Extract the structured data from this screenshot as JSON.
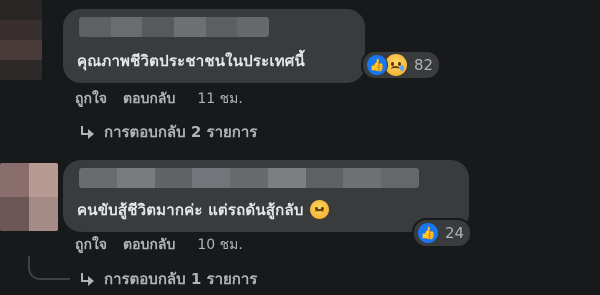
{
  "comments": [
    {
      "text": "คุณภาพชีวิตประชาชนในประเทศนี้",
      "reactions": {
        "icons": [
          "like-icon",
          "sad-icon"
        ],
        "count": "82"
      },
      "actions": {
        "like": "ถูกใจ",
        "reply": "ตอบกลับ",
        "time": "11 ชม."
      },
      "replies_label": "การตอบกลับ 2 รายการ"
    },
    {
      "text": "คนขับสู้ชีวิตมากค่ะ แต่รถดันสู้กลับ",
      "inline_emoji": "sad-face-emoji",
      "reactions": {
        "icons": [
          "like-icon"
        ],
        "count": "24"
      },
      "actions": {
        "like": "ถูกใจ",
        "reply": "ตอบกลับ",
        "time": "10 ชม."
      },
      "replies_label": "การตอบกลับ 1 รายการ"
    }
  ],
  "colors": {
    "background": "#18191a",
    "bubble": "#3a3b3c",
    "text_primary": "#e4e6eb",
    "text_secondary": "#b0b3b8",
    "like_blue": "#1877f2"
  }
}
